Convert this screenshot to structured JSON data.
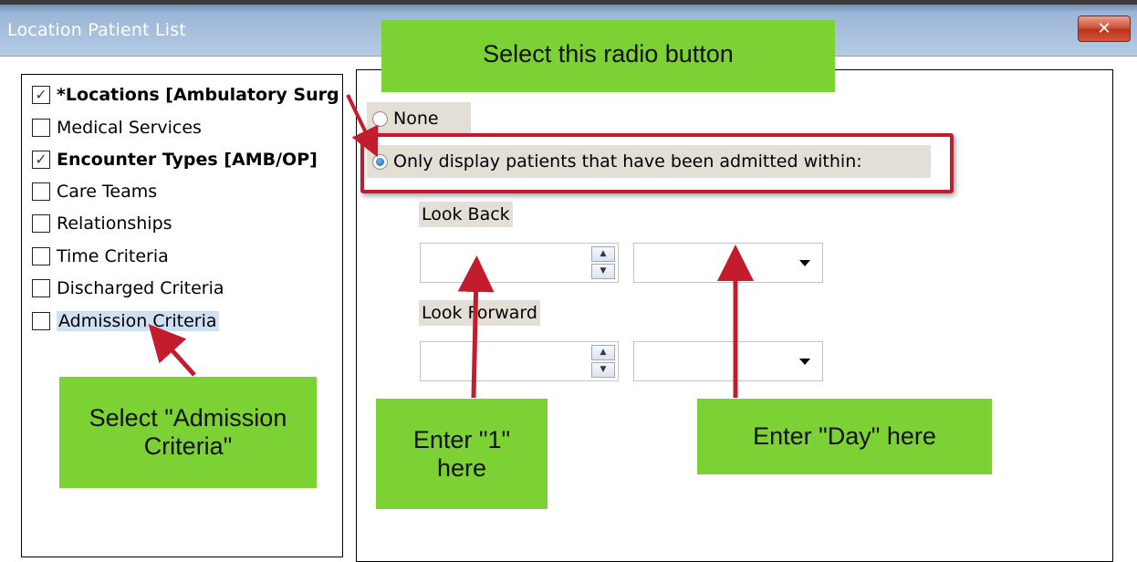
{
  "window": {
    "title": "Location Patient List",
    "close_glyph": "✕"
  },
  "criteria": [
    {
      "label": "*Locations [Ambulatory Surg",
      "checked": true,
      "bold": true
    },
    {
      "label": "Medical Services",
      "checked": false,
      "bold": false
    },
    {
      "label": "Encounter Types [AMB/OP]",
      "checked": true,
      "bold": true
    },
    {
      "label": "Care Teams",
      "checked": false,
      "bold": false
    },
    {
      "label": "Relationships",
      "checked": false,
      "bold": false
    },
    {
      "label": "Time Criteria",
      "checked": false,
      "bold": false
    },
    {
      "label": "Discharged Criteria",
      "checked": false,
      "bold": false
    },
    {
      "label": "Admission Criteria",
      "checked": false,
      "bold": false,
      "selected": true
    }
  ],
  "options": {
    "none_label": "None",
    "admitted_label": "Only display patients that have been admitted within:",
    "selected": "admitted",
    "look_back_label": "Look Back",
    "look_forward_label": "Look Forward",
    "look_back_value": "",
    "look_back_unit": "",
    "look_forward_value": "",
    "look_forward_unit": ""
  },
  "spinner": {
    "up": "▲",
    "down": "▼"
  },
  "annotations": {
    "select_radio": "Select this radio button",
    "select_admission": "Select \"Admission Criteria\"",
    "enter_one": "Enter \"1\" here",
    "enter_day": "Enter \"Day\" here"
  },
  "colors": {
    "callout_green": "#7cd135",
    "arrow_red": "#c31c2d",
    "titlebar_blue": "#9cb6d6"
  }
}
